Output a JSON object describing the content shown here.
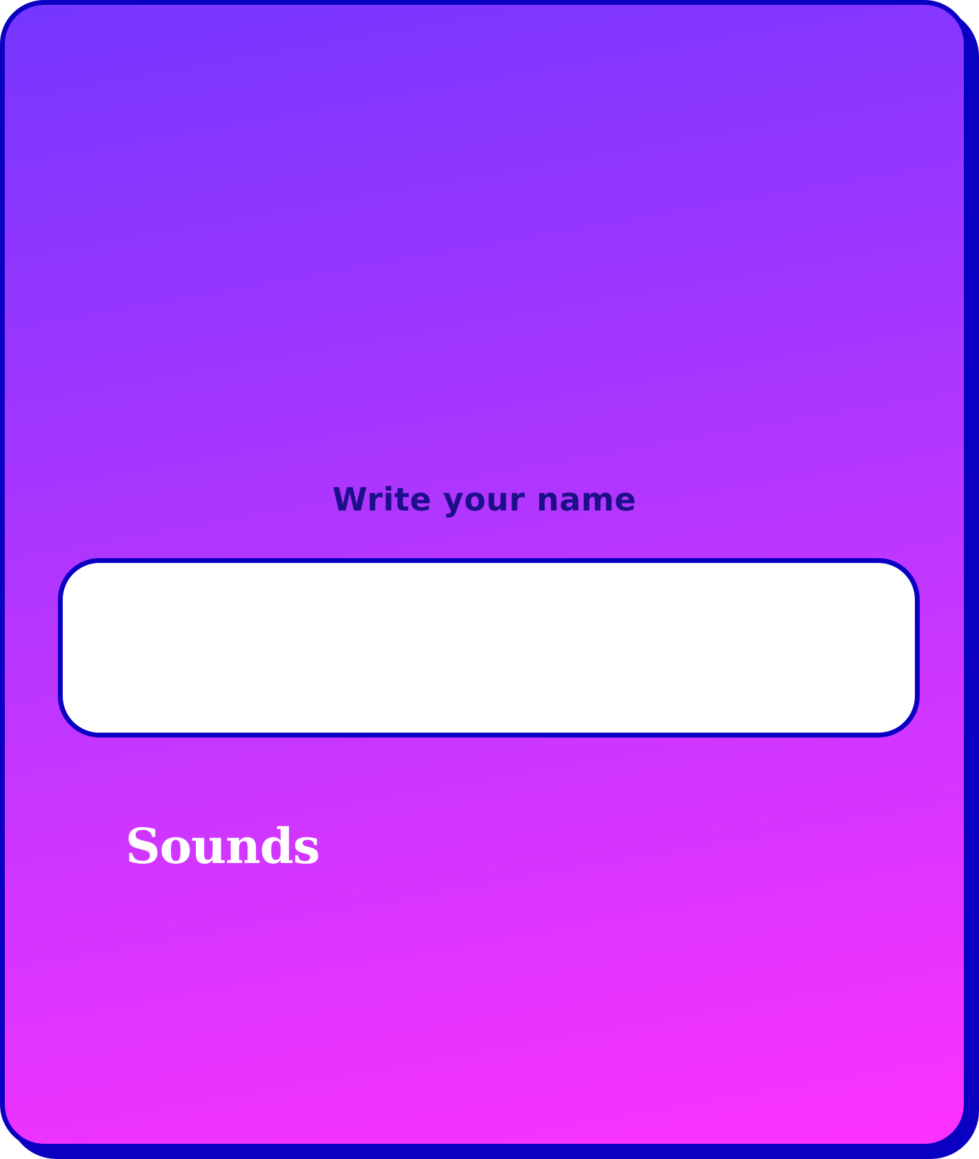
{
  "name_form": {
    "prompt": "Write your name",
    "name_value": "",
    "name_placeholder": ""
  },
  "settings": {
    "sounds_label": "Sounds"
  },
  "colors": {
    "border": "#0a00c2",
    "gradient_top": "#7536ff",
    "gradient_bottom": "#fe31ff",
    "prompt_text": "#1d0f8a",
    "input_bg": "#ffffff",
    "sounds_text": "#ffffff"
  }
}
